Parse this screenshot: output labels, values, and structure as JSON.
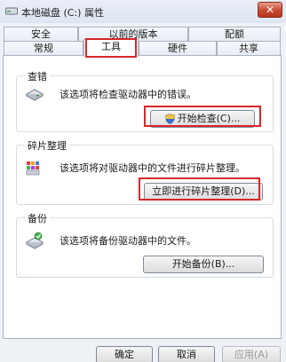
{
  "window": {
    "title": "本地磁盘 (C:) 属性",
    "close_label": "✕"
  },
  "tabs_top": [
    {
      "label": "安全"
    },
    {
      "label": "以前的版本"
    },
    {
      "label": "配额"
    }
  ],
  "tabs_bottom": [
    {
      "label": "常规"
    },
    {
      "label": "工具",
      "active": true
    },
    {
      "label": "硬件"
    },
    {
      "label": "共享"
    }
  ],
  "groups": {
    "error_check": {
      "label": "查错",
      "description": "该选项将检查驱动器中的错误。",
      "button": "开始检查(C)..."
    },
    "defrag": {
      "label": "碎片整理",
      "description": "该选项将对驱动器中的文件进行碎片整理。",
      "button": "立即进行碎片整理(D)..."
    },
    "backup": {
      "label": "备份",
      "description": "该选项将备份驱动器中的文件。",
      "button": "开始备份(B)..."
    }
  },
  "footer": {
    "ok": "确定",
    "cancel": "取消",
    "apply": "应用(A)"
  },
  "colors": {
    "highlight": "#d9262a",
    "window_bg": "#eef1f6"
  }
}
